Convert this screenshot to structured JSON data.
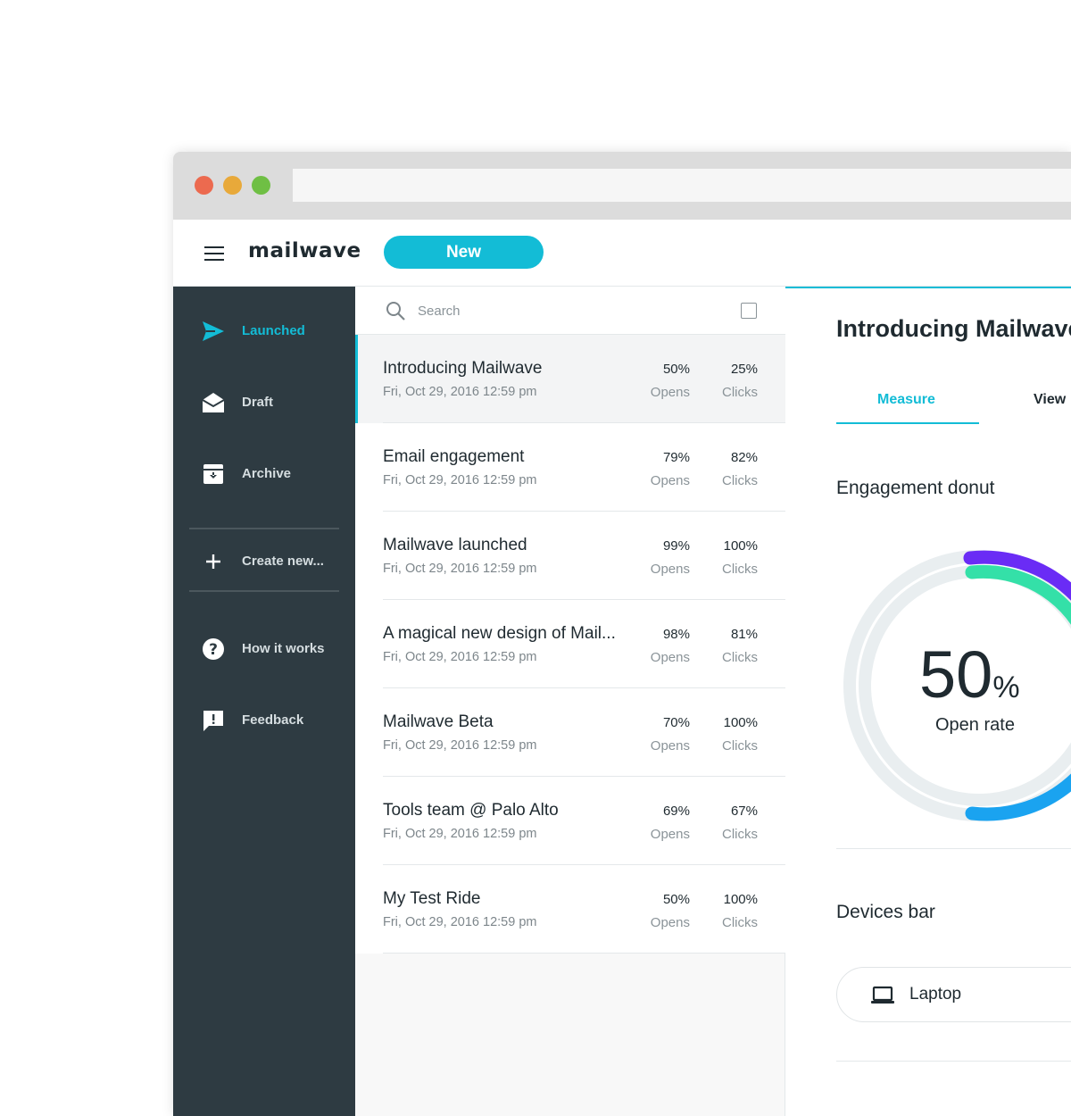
{
  "app": {
    "logo_text": "mailwave",
    "new_button": "New"
  },
  "colors": {
    "accent": "#13bcd6",
    "sidebar_bg": "#2e3b42",
    "donut_purple": "#6a2cf5",
    "donut_green": "#34e0a8",
    "donut_blue": "#1aa3f0",
    "donut_track": "#e9eef0"
  },
  "sidebar": {
    "items": [
      {
        "label": "Launched",
        "icon": "send-icon",
        "active": true
      },
      {
        "label": "Draft",
        "icon": "envelope-open-icon",
        "active": false
      },
      {
        "label": "Archive",
        "icon": "archive-icon",
        "active": false
      },
      {
        "label": "Create new...",
        "icon": "plus-icon",
        "active": false
      },
      {
        "label": "How it works",
        "icon": "help-icon",
        "active": false
      },
      {
        "label": "Feedback",
        "icon": "feedback-icon",
        "active": false
      }
    ]
  },
  "list": {
    "search_placeholder": "Search",
    "opens_label": "Opens",
    "clicks_label": "Clicks",
    "rows": [
      {
        "title": "Introducing Mailwave",
        "date": "Fri, Oct 29, 2016  12:59 pm",
        "opens": "50%",
        "clicks": "25%"
      },
      {
        "title": "Email engagement",
        "date": "Fri, Oct 29, 2016  12:59 pm",
        "opens": "79%",
        "clicks": "82%"
      },
      {
        "title": "Mailwave launched",
        "date": "Fri, Oct 29, 2016  12:59 pm",
        "opens": "99%",
        "clicks": "100%"
      },
      {
        "title": "A magical new design of Mail...",
        "date": "Fri, Oct 29, 2016  12:59 pm",
        "opens": "98%",
        "clicks": "81%"
      },
      {
        "title": "Mailwave Beta",
        "date": "Fri, Oct 29, 2016  12:59 pm",
        "opens": "70%",
        "clicks": "100%"
      },
      {
        "title": "Tools team @ Palo Alto",
        "date": "Fri, Oct 29, 2016  12:59 pm",
        "opens": "69%",
        "clicks": "67%"
      },
      {
        "title": "My Test Ride",
        "date": "Fri, Oct 29, 2016  12:59 pm",
        "opens": "50%",
        "clicks": "100%"
      }
    ]
  },
  "detail": {
    "title": "Introducing Mailwave",
    "tabs": {
      "measure": "Measure",
      "view": "View"
    },
    "engagement_title": "Engagement donut",
    "donut": {
      "value": "50",
      "unit": "%",
      "label": "Open rate"
    },
    "devices_title": "Devices bar",
    "device": {
      "label": "Laptop",
      "icon": "laptop-icon"
    }
  }
}
